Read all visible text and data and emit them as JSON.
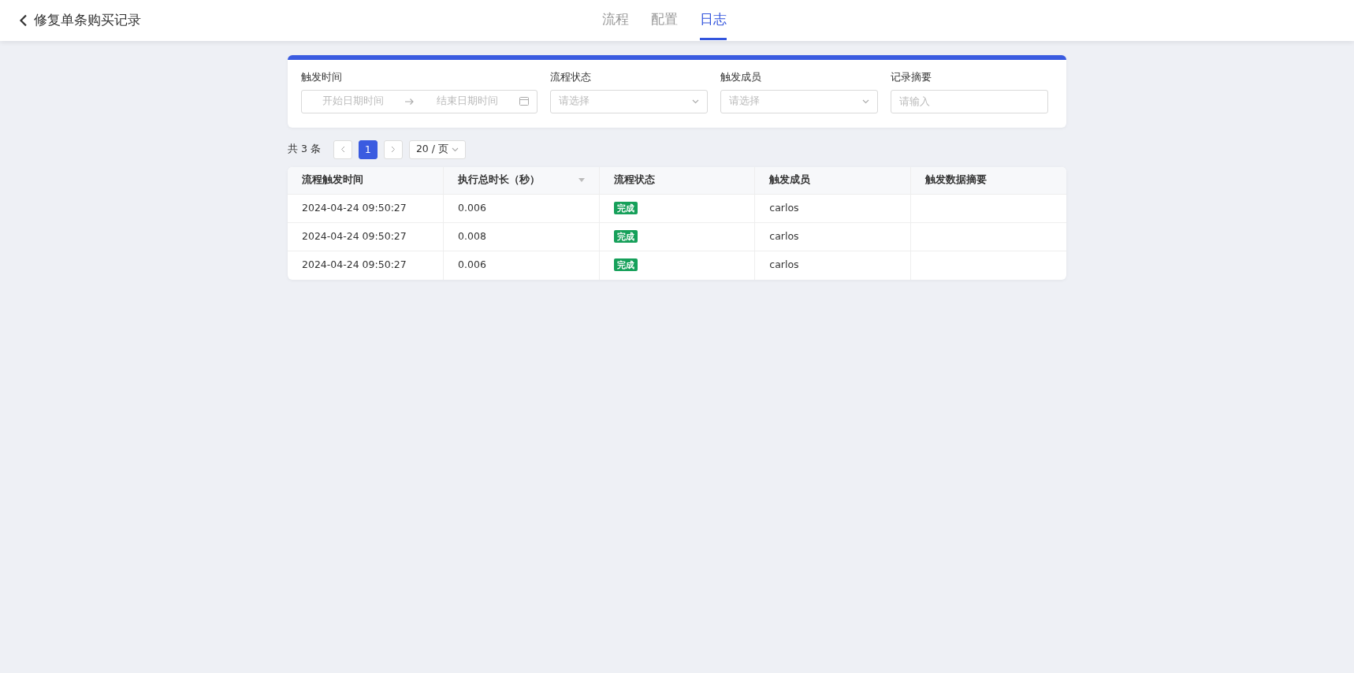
{
  "header": {
    "title": "修复单条购买记录",
    "tabs": [
      {
        "label": "流程",
        "selected": false
      },
      {
        "label": "配置",
        "selected": false
      },
      {
        "label": "日志",
        "selected": true
      }
    ]
  },
  "filters": [
    {
      "kind": "daterange",
      "label": "触发时间",
      "start_placeholder": "开始日期时间",
      "end_placeholder": "结束日期时间"
    },
    {
      "kind": "select",
      "label": "流程状态",
      "placeholder": "请选择"
    },
    {
      "kind": "select",
      "label": "触发成员",
      "placeholder": "请选择"
    },
    {
      "kind": "input",
      "label": "记录摘要",
      "placeholder": "请输入"
    }
  ],
  "pagination": {
    "total": "共 3 条",
    "pages": [
      {
        "label": "1",
        "selected": true
      }
    ],
    "page_size": "20 / 页"
  },
  "table": {
    "columns": [
      {
        "label": "流程触发时间",
        "sortable": false
      },
      {
        "label": "执行总时长（秒）",
        "sortable": true
      },
      {
        "label": "流程状态",
        "sortable": false
      },
      {
        "label": "触发成员",
        "sortable": false
      },
      {
        "label": "触发数据摘要",
        "sortable": false
      }
    ],
    "rows": [
      {
        "time": "2024-04-24 09:50:27",
        "duration": "0.006",
        "status": "完成",
        "member": "carlos"
      },
      {
        "time": "2024-04-24 09:50:27",
        "duration": "0.008",
        "status": "完成",
        "member": "carlos"
      },
      {
        "time": "2024-04-24 09:50:27",
        "duration": "0.006",
        "status": "完成",
        "member": "carlos"
      }
    ]
  }
}
